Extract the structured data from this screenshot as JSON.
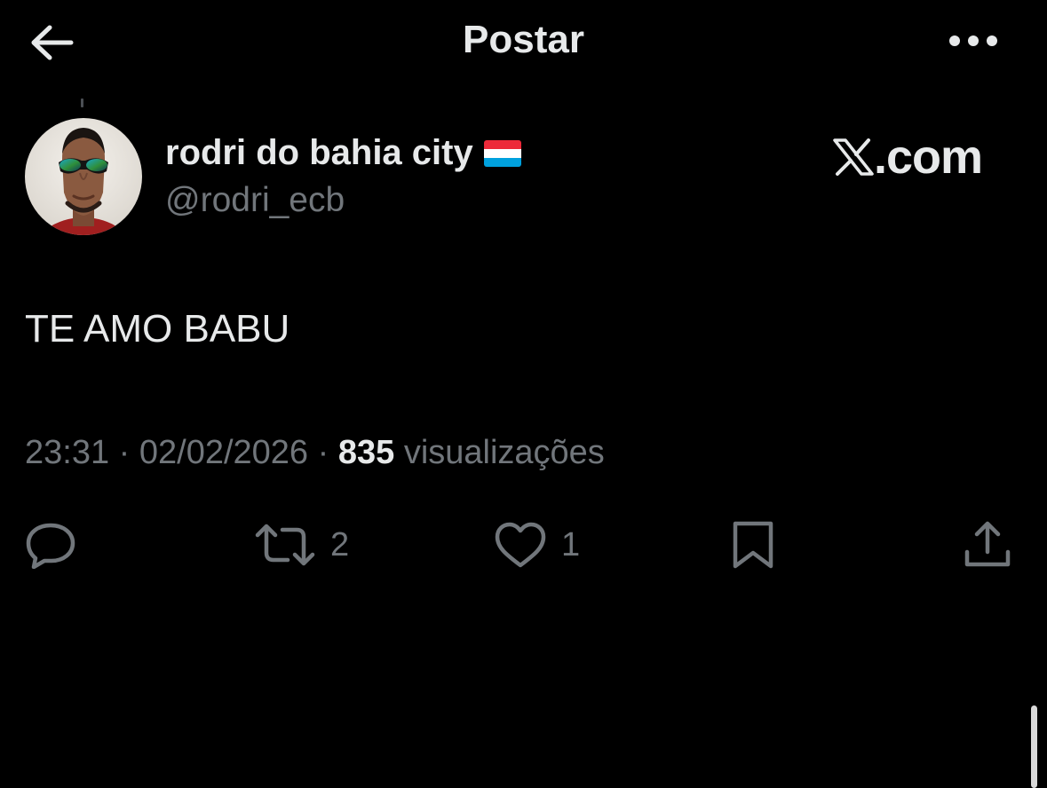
{
  "header": {
    "title": "Postar",
    "back_icon": "arrow-left-icon",
    "more_icon": "more-horizontal-icon"
  },
  "author": {
    "display_name": "rodri do bahia city",
    "flag_icon": "luxembourg-flag-icon",
    "handle": "@rodri_ecb"
  },
  "watermark": {
    "logo_icon": "x-logo-icon",
    "text": ".com"
  },
  "tweet": {
    "text": "TE AMO BABU"
  },
  "meta": {
    "time": "23:31",
    "separator": " · ",
    "date": "02/02/2026",
    "views_count": "835",
    "views_label": "visualizações"
  },
  "actions": {
    "reply": {
      "icon": "reply-icon",
      "count": ""
    },
    "repost": {
      "icon": "repost-icon",
      "count": "2"
    },
    "like": {
      "icon": "heart-icon",
      "count": "1"
    },
    "bookmark": {
      "icon": "bookmark-icon",
      "count": ""
    },
    "share": {
      "icon": "share-icon",
      "count": ""
    }
  },
  "colors": {
    "background": "#000000",
    "primary_text": "#e7e9ea",
    "secondary_text": "#71767b"
  }
}
